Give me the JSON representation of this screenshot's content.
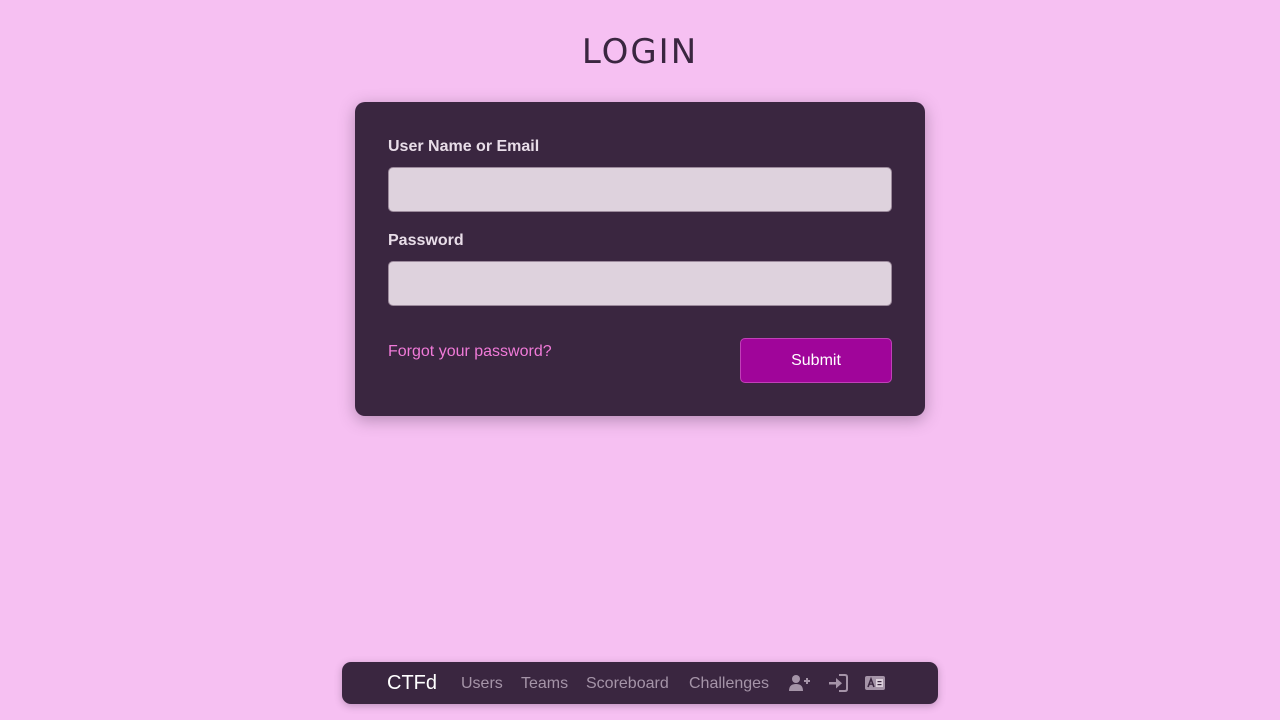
{
  "page": {
    "title": "LOGIN"
  },
  "form": {
    "username_label": "User Name or Email",
    "username_value": "",
    "password_label": "Password",
    "password_value": "",
    "forgot_link": "Forgot your password?",
    "submit_label": "Submit"
  },
  "navbar": {
    "brand": "CTFd",
    "links": [
      {
        "label": "Users"
      },
      {
        "label": "Teams"
      },
      {
        "label": "Scoreboard"
      },
      {
        "label": "Challenges"
      }
    ],
    "icons": [
      {
        "name": "register-icon"
      },
      {
        "name": "login-icon"
      },
      {
        "name": "language-icon"
      }
    ]
  },
  "colors": {
    "background": "#f6c0f2",
    "card": "#3a2640",
    "accent": "#a0059a",
    "link": "#f07ad8",
    "nav_text": "#a594a8"
  }
}
